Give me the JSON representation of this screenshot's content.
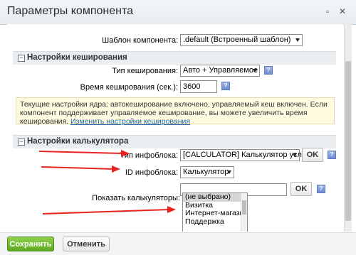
{
  "dialog": {
    "title": "Параметры компонента",
    "save_label": "Сохранить",
    "cancel_label": "Отменить"
  },
  "template": {
    "label": "Шаблон компонента:",
    "value": ".default (Встроенный шаблон)"
  },
  "caching": {
    "section_title": "Настройки кеширования",
    "type_label": "Тип кеширования:",
    "type_value": "Авто + Управляемое",
    "time_label": "Время кеширования (сек.):",
    "time_value": "3600",
    "notice_text": "Текущие настройки ядра: автокеширование включено, управляемый кеш включен. Если компонент поддерживает управляемое кеширование, вы можете увеличить время кеширования.",
    "notice_link": "Изменить настройки кеширования"
  },
  "calculator": {
    "section_title": "Настройки калькулятора",
    "iblock_type_label": "Тип инфоблока:",
    "iblock_type_value": "[CALCULATOR] Калькулятор услуг",
    "ok_label": "OK",
    "iblock_id_label": "ID инфоблока:",
    "iblock_id_value": "Калькулятор",
    "ok2_label": "OK",
    "show_label": "Показать калькуляторы:",
    "show_options": [
      "(не выбрано)",
      "Визитка",
      "Интернет-магазин",
      "Поддержка"
    ]
  },
  "colors": {
    "arrow": "#e8231f",
    "save_button": "#6cb52f"
  }
}
